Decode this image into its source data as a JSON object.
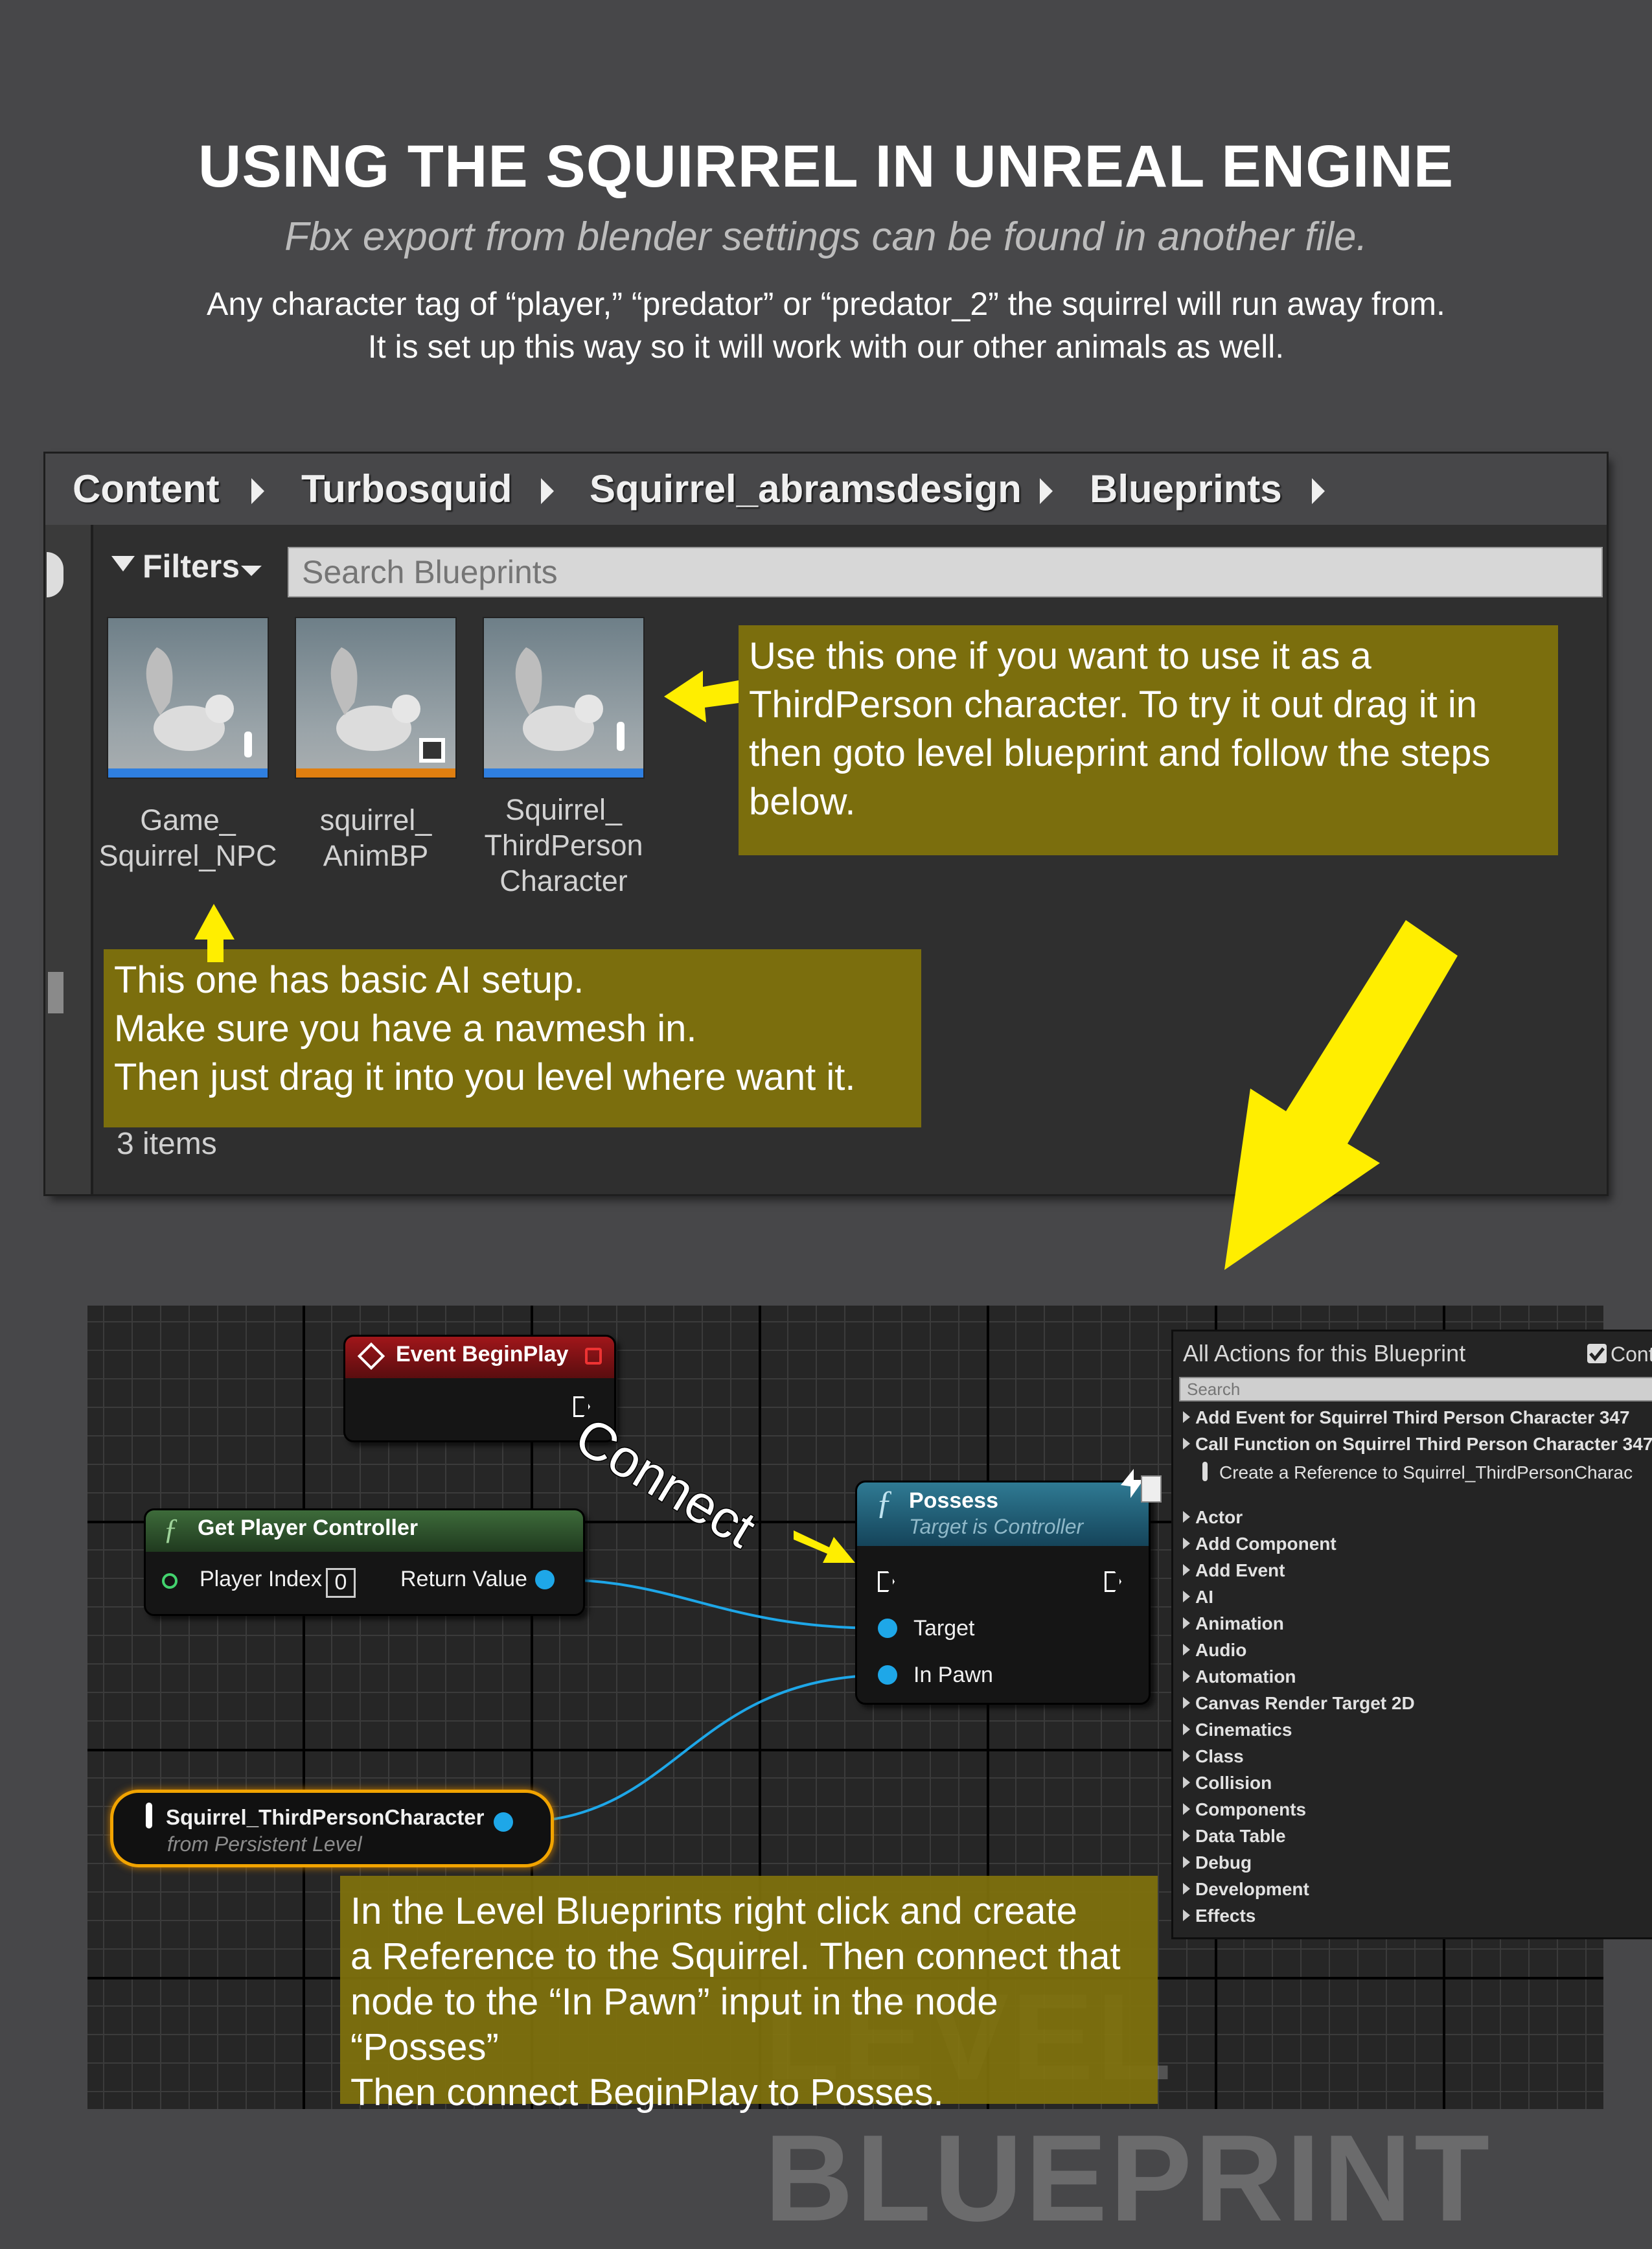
{
  "header": {
    "title": "USING THE SQUIRREL IN UNREAL ENGINE",
    "subtitle": "Fbx export from blender settings can be found in another file.",
    "intro_line1": "Any character tag of “player,” “predator” or “predator_2” the squirrel will run away from.",
    "intro_line2": "It is set up this way so it will work with our other animals as well."
  },
  "content_browser": {
    "breadcrumbs": [
      "Content",
      "Turbosquid",
      "Squirrel_abramsdesign",
      "Blueprints"
    ],
    "filters_label": "Filters",
    "search_placeholder": "Search Blueprints",
    "assets": [
      {
        "label_line1": "Game_",
        "label_line2": "Squirrel_NPC",
        "label_line3": "",
        "bar_color": "#2f7fe0"
      },
      {
        "label_line1": "squirrel_",
        "label_line2": "AnimBP",
        "label_line3": "",
        "bar_color": "#e07f10"
      },
      {
        "label_line1": "Squirrel_",
        "label_line2": "ThirdPerson",
        "label_line3": "Character",
        "bar_color": "#2f7fe0"
      }
    ],
    "items_count": "3 items"
  },
  "notes": {
    "third_person": "Use this one if you want to use it as a ThirdPerson character. To try it out drag it in then goto level blueprint and follow the steps below.",
    "npc_line1": "This one has basic AI setup.",
    "npc_line2": "Make sure you have a navmesh in.",
    "npc_line3": "Then just drag it into you level where want it.",
    "level_line1": "In the Level Blueprints right click and create",
    "level_line2": "a Reference to the Squirrel. Then connect that",
    "level_line3": "node to the “In Pawn” input in the node “Posses”",
    "level_line4": "Then connect BeginPlay to Posses."
  },
  "graph": {
    "connect_label": "Connect",
    "watermark": "LEVEL BLUEPRINT",
    "event_begin_play": "Event BeginPlay",
    "get_player_controller": {
      "title": "Get Player Controller",
      "player_index_label": "Player Index",
      "player_index_value": "0",
      "return_value_label": "Return Value"
    },
    "possess": {
      "title": "Possess",
      "subtitle": "Target is Controller",
      "target_label": "Target",
      "in_pawn_label": "In Pawn"
    },
    "reference_node": {
      "title": "Squirrel_ThirdPersonCharacter",
      "subtitle": "from Persistent Level"
    }
  },
  "actions_panel": {
    "title": "All Actions for this Blueprint",
    "context_label": "Cont",
    "search_placeholder": "Search",
    "top_items": [
      "Add Event for Squirrel Third Person Character 347",
      "Call Function on Squirrel Third Person Character 347"
    ],
    "reference_item": "Create a Reference to Squirrel_ThirdPersonCharac",
    "categories": [
      "Actor",
      "Add Component",
      "Add Event",
      "AI",
      "Animation",
      "Audio",
      "Automation",
      "Canvas Render Target 2D",
      "Cinematics",
      "Class",
      "Collision",
      "Components",
      "Data Table",
      "Debug",
      "Development",
      "Effects"
    ]
  },
  "colors": {
    "background": "#474749",
    "note_fill": "#80720c",
    "arrow": "#ffee00",
    "pin_blue": "#1ea7e8",
    "ref_border": "#f2a400"
  }
}
